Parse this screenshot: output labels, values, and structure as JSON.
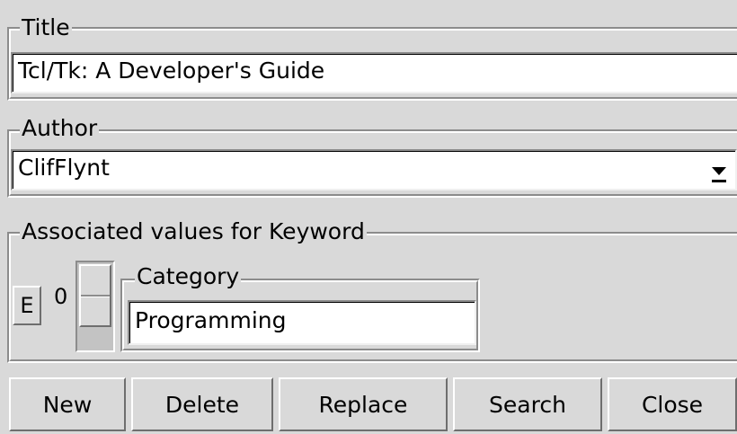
{
  "title_section": {
    "legend": "Title",
    "value": "Tcl/Tk: A Developer's Guide"
  },
  "author_section": {
    "legend": "Author",
    "value": "ClifFlynt",
    "dropdown_icon": "chevron-down-icon"
  },
  "keyword_section": {
    "legend": "Associated values for Keyword",
    "edit_button_label": "E",
    "scale_value": "0",
    "category": {
      "legend": "Category",
      "value": "Programming"
    }
  },
  "buttons": {
    "new": "New",
    "delete": "Delete",
    "replace": "Replace",
    "search": "Search",
    "close": "Close"
  }
}
